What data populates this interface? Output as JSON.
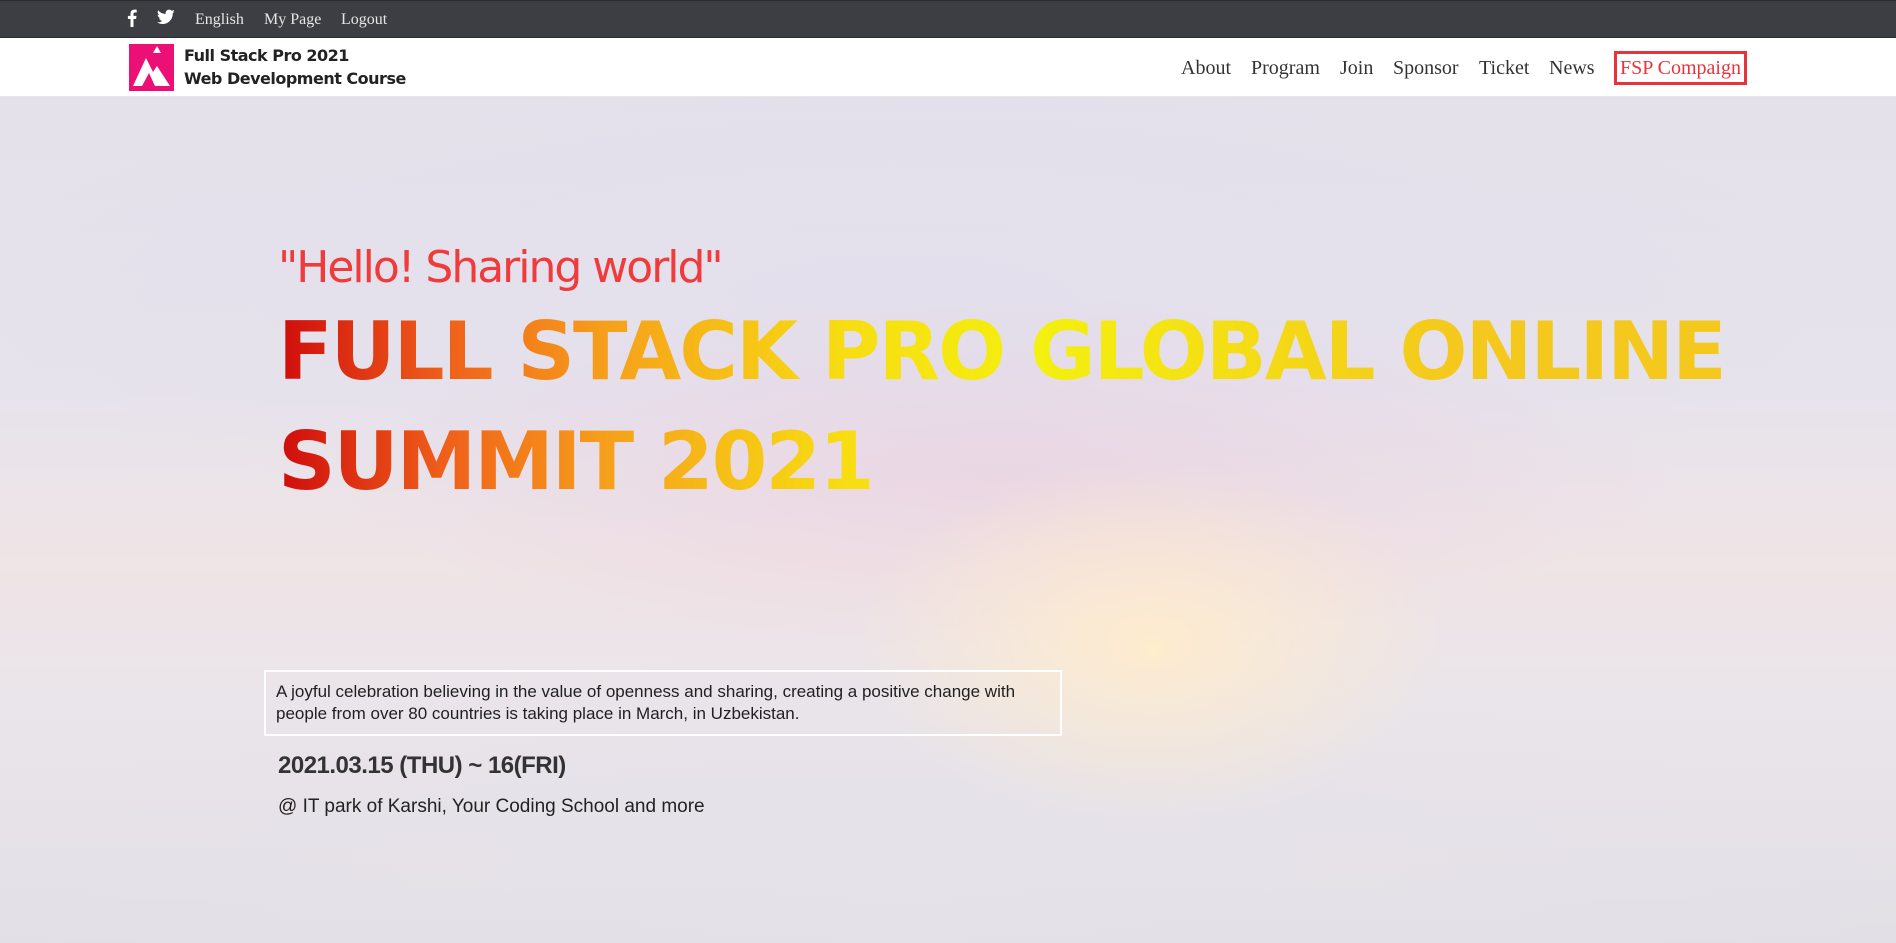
{
  "topbar": {
    "social": [
      {
        "icon": "facebook-icon"
      },
      {
        "icon": "twitter-icon"
      }
    ],
    "language": "English",
    "my_page": "My Page",
    "logout": "Logout"
  },
  "header": {
    "brand_line1": "Full Stack Pro 2021",
    "brand_line2": "Web Development Course",
    "logo_color": "#ec0f75",
    "nav": [
      "About",
      "Program",
      "Join",
      "Sponsor",
      "Ticket",
      "News"
    ],
    "cta": "FSP Compaign",
    "cta_color": "#e8333a"
  },
  "hero": {
    "tagline": "\"Hello! Sharing world\"",
    "title_line1": "FULL STACK PRO GLOBAL ONLINE",
    "title_line2": "SUMMIT 2021",
    "description": "A joyful celebration believing in the value of openness and sharing, creating a positive change with people from over 80 countries is taking place in March, in Uzbekistan.",
    "date": "2021.03.15 (THU) ~ 16(FRI)",
    "venue": "@ IT park of Karshi, Your Coding School and more"
  }
}
